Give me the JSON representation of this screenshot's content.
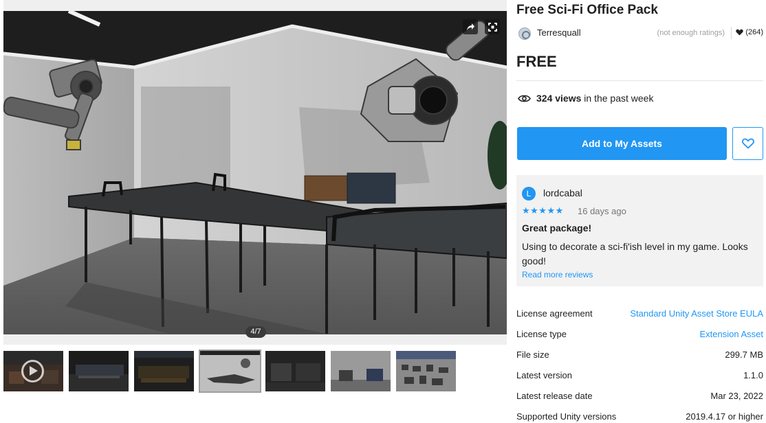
{
  "product": {
    "title": "Free Sci-Fi Office Pack",
    "publisher": "Terresquall",
    "ratings_note": "(not enough ratings)",
    "favorites_count": "(264)",
    "price": "FREE",
    "views_count": "324 views",
    "views_suffix": "in the past week",
    "add_button_label": "Add to My Assets"
  },
  "media": {
    "counter": "4/7",
    "thumbnail_count": 7,
    "share_icon": "share-icon",
    "fullscreen_icon": "fullscreen-icon"
  },
  "review": {
    "avatar_initial": "L",
    "username": "lordcabal",
    "stars": "★★★★★",
    "rating": 5,
    "date": "16 days ago",
    "headline": "Great package!",
    "body": "Using to decorate a sci-fi'ish level in my game. Looks good!",
    "read_more": "Read more reviews"
  },
  "details": [
    {
      "label": "License agreement",
      "value": "Standard Unity Asset Store EULA",
      "is_link": true
    },
    {
      "label": "License type",
      "value": "Extension Asset",
      "is_link": true
    },
    {
      "label": "File size",
      "value": "299.7 MB",
      "is_link": false
    },
    {
      "label": "Latest version",
      "value": "1.1.0",
      "is_link": false
    },
    {
      "label": "Latest release date",
      "value": "Mar 23, 2022",
      "is_link": false
    },
    {
      "label": "Supported Unity versions",
      "value": "2019.4.17 or higher",
      "is_link": false
    }
  ],
  "colors": {
    "accent": "#2196f3",
    "review_bg": "#f2f2f2",
    "text": "#212121",
    "muted": "#9e9e9e"
  }
}
